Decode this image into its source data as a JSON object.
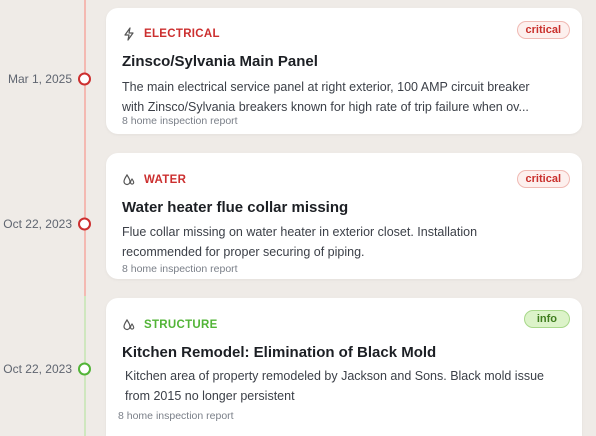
{
  "timeline": [
    {
      "date": "Mar 1, 2025",
      "category": "ELECTRICAL",
      "category_icon": "bolt-icon",
      "badge": "critical",
      "title": "Zinsco/Sylvania Main Panel",
      "description": "The main electrical service panel at right exterior, 100 AMP circuit breaker with Zinsco/Sylvania breakers known for high rate of trip failure when ov...",
      "source": "8 home inspection report"
    },
    {
      "date": "Oct 22, 2023",
      "category": "WATER",
      "category_icon": "water-drops-icon",
      "badge": "critical",
      "title": "Water heater flue collar missing",
      "description": "Flue collar missing on water heater in exterior closet. Installation recommended for proper securing of piping.",
      "source": "8 home inspection report"
    },
    {
      "date": "Oct 22, 2023",
      "category": "STRUCTURE",
      "category_icon": "water-drops-icon",
      "badge": "info",
      "title": "Kitchen Remodel: Elimination of Black Mold",
      "description": "Kitchen area of property remodeled by Jackson and Sons. Black mold issue from 2015 no longer persistent",
      "source": "8 home inspection report"
    }
  ],
  "colors": {
    "critical": "#cc2f2f",
    "structure": "#52b437",
    "background": "#efebe7"
  }
}
